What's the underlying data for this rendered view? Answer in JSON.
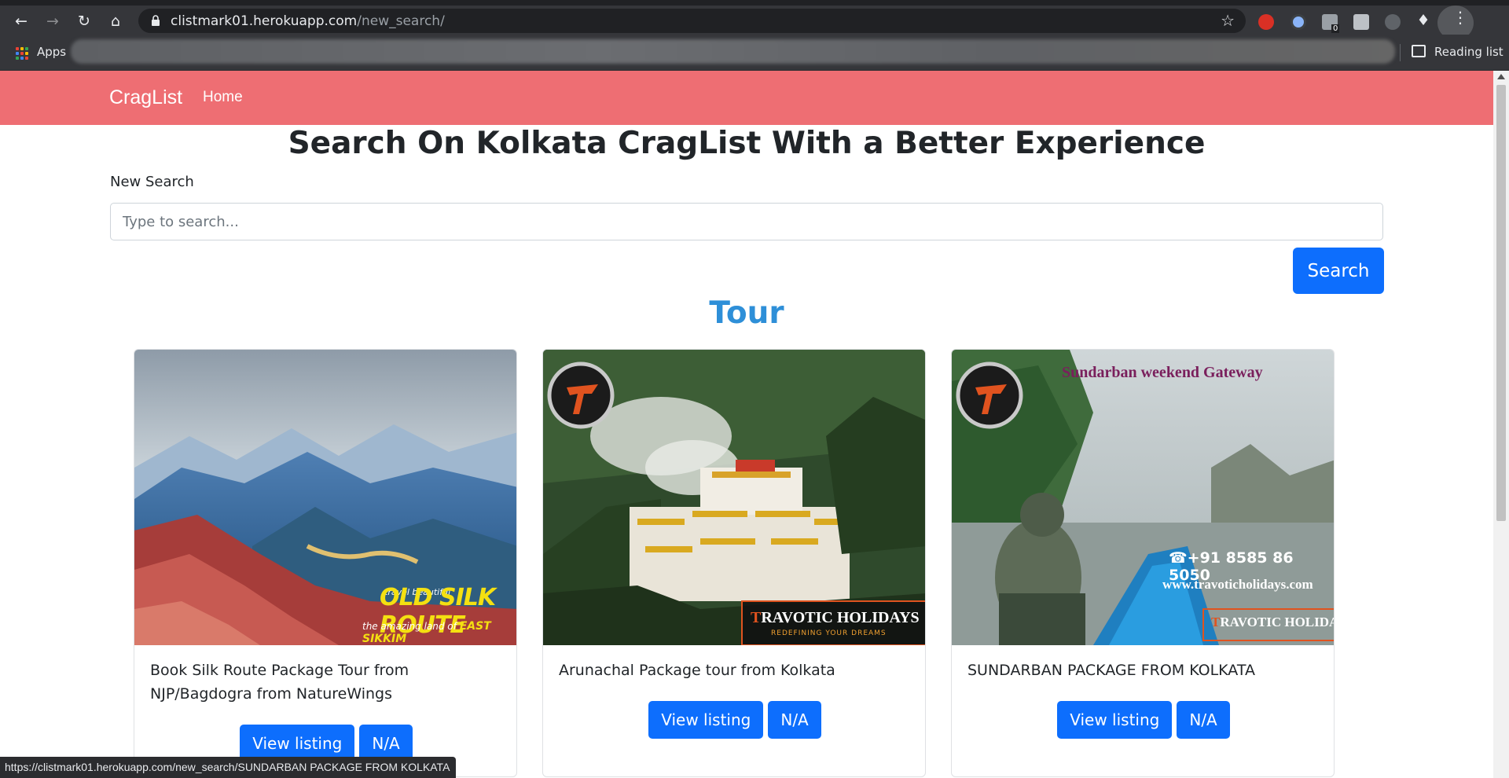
{
  "browser": {
    "url_host": "clistmark01.herokuapp.com",
    "url_path": "/new_search/",
    "bookmarks": {
      "apps_label": "Apps",
      "reading_list_label": "Reading list"
    },
    "extension_badge": "0",
    "status_url": "https://clistmark01.herokuapp.com/new_search/SUNDARBAN PACKAGE FROM KOLKATA"
  },
  "navbar": {
    "brand": "CragList",
    "home": "Home"
  },
  "page": {
    "headline": "Search On Kolkata CragList With a Better Experience",
    "search_label": "New Search",
    "search_placeholder": "Type to search...",
    "search_button": "Search",
    "section_title": "Tour"
  },
  "cards": [
    {
      "title": "Book Silk Route Package Tour from NJP/Bagdogra from NatureWings",
      "view_label": "View listing",
      "price_label": "N/A",
      "image": {
        "overlay_main": "OLD SILK ROUTE",
        "overlay_small": "travel beautiful",
        "overlay_sub": "the amazing land of",
        "overlay_sub2": "EAST SIKKIM"
      }
    },
    {
      "title": "Arunachal Package tour from Kolkata",
      "view_label": "View listing",
      "price_label": "N/A",
      "image": {
        "logo_brand": "RAVOTIC HOLIDAYS",
        "logo_tagline": "REDEFINING YOUR DREAMS"
      }
    },
    {
      "title": "SUNDARBAN PACKAGE FROM KOLKATA",
      "view_label": "View listing",
      "price_label": "N/A",
      "image": {
        "banner": "Sundarban weekend Gateway",
        "phone": "+91 8585 86 5050",
        "website": "www.travoticholidays.com",
        "logo_brand": "RAVOTIC HOLIDAYS"
      }
    }
  ],
  "colors": {
    "navbar": "#ee6e73",
    "primary": "#0d6efd",
    "section_title": "#2e8fd8"
  }
}
